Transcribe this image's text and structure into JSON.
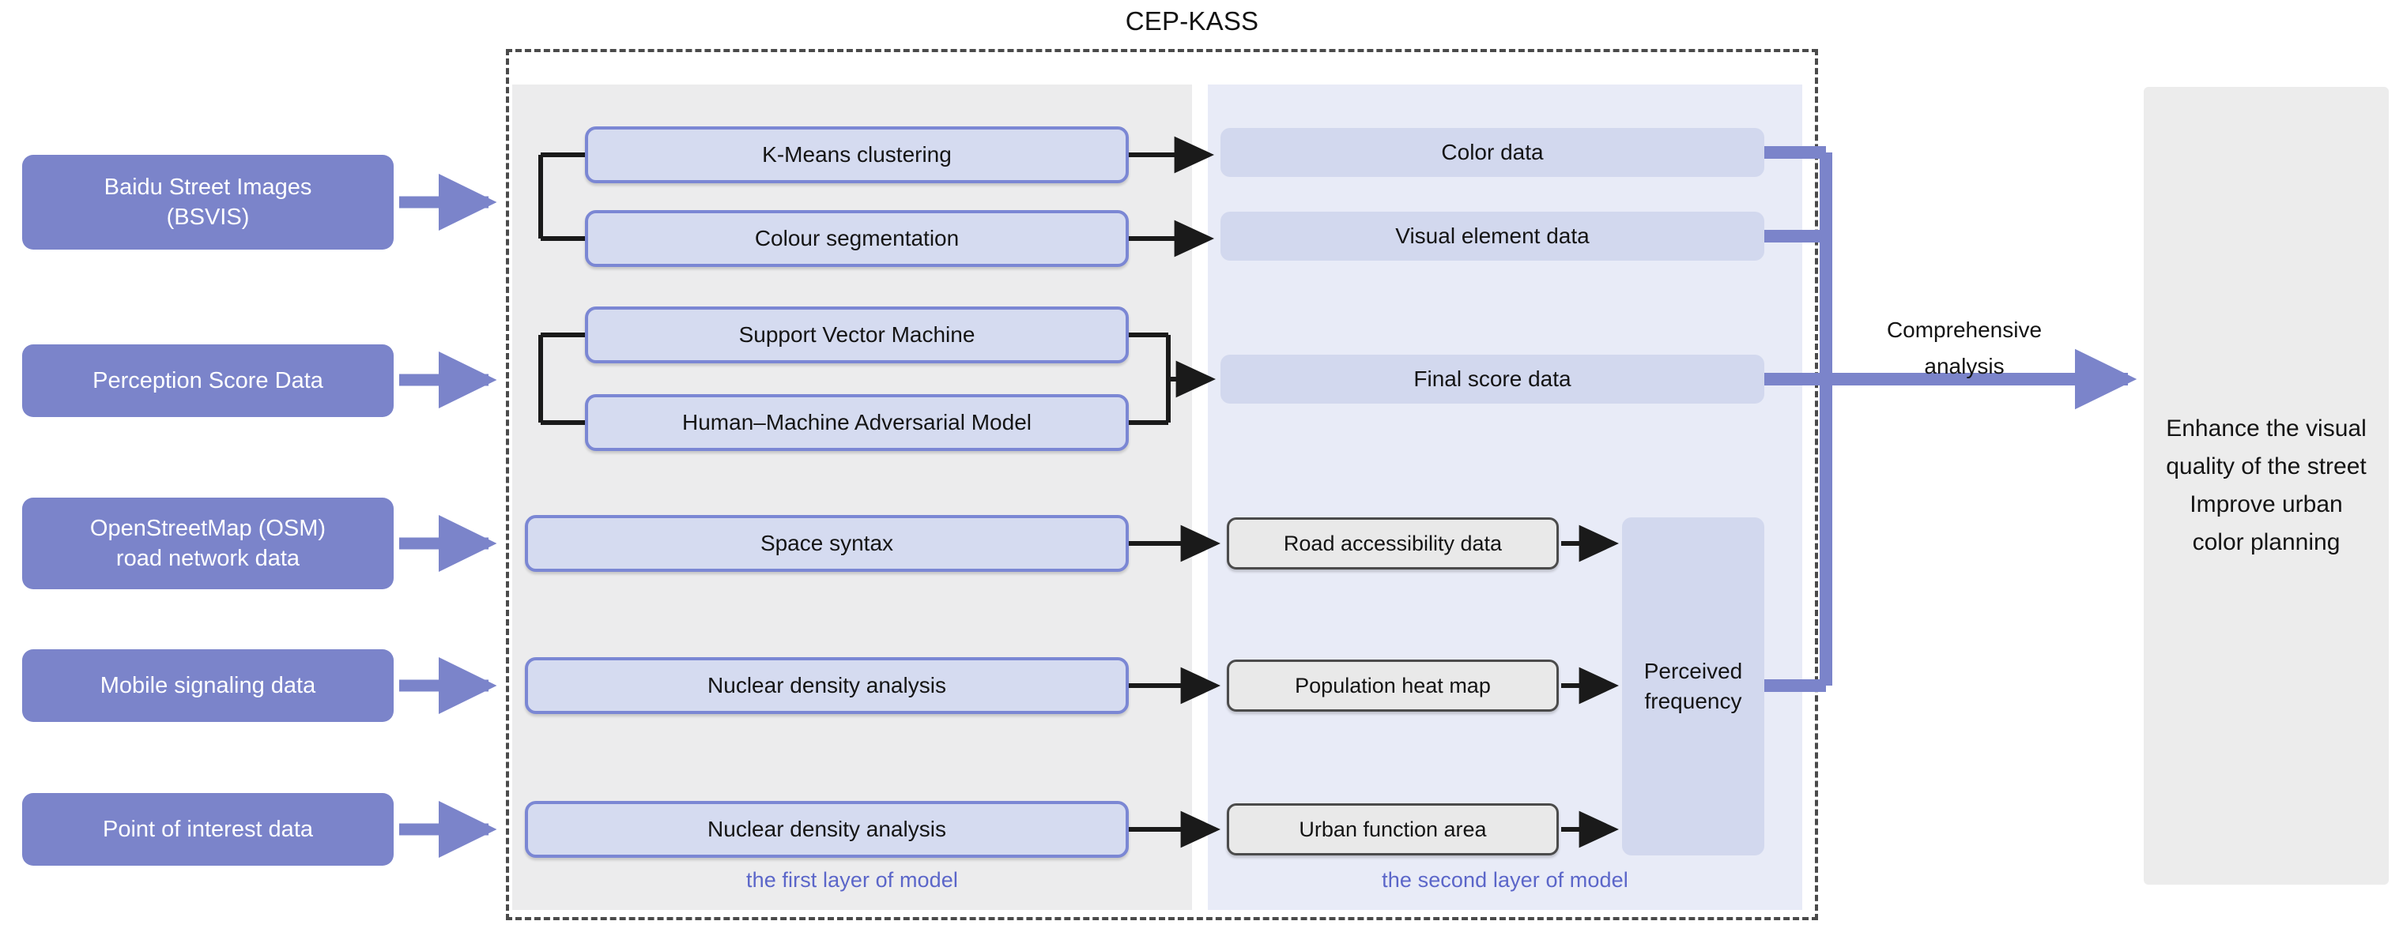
{
  "diagram": {
    "title": "CEP-KASS",
    "comprehensive_analysis_line1": "Comprehensive",
    "comprehensive_analysis_line2": "analysis",
    "first_layer_caption": "the first layer of model",
    "second_layer_caption": "the second layer of model"
  },
  "colors": {
    "source_box_fill": "#7b84ca",
    "method_box_fill": "#d5dbf0",
    "method_box_border": "#7b87d4",
    "data_box_fill": "#d2d8ee",
    "grey_box_fill": "#e9e9e9",
    "grey_box_border": "#4b4b4b",
    "panel_first_fill": "#ececed",
    "panel_second_fill": "#e8ebf7",
    "outcome_fill": "#ececec",
    "accent_arrow": "#7b84ca",
    "caption_text": "#5b66c9",
    "frame_dash": "#4a4a4a",
    "black_connector": "#1a1a1a"
  },
  "sources": [
    {
      "id": "bsvis",
      "line1": "Baidu Street Images",
      "line2": "(BSVIS)"
    },
    {
      "id": "perception",
      "line1": "Perception Score Data",
      "line2": ""
    },
    {
      "id": "osm",
      "line1": "OpenStreetMap (OSM)",
      "line2": "road network data"
    },
    {
      "id": "mobile",
      "line1": "Mobile signaling data",
      "line2": ""
    },
    {
      "id": "poi",
      "line1": "Point of interest data",
      "line2": ""
    }
  ],
  "first_layer": [
    {
      "id": "kmeans",
      "label": "K-Means clustering"
    },
    {
      "id": "colourseg",
      "label": "Colour segmentation"
    },
    {
      "id": "svm",
      "label": "Support Vector Machine"
    },
    {
      "id": "hmam",
      "label": "Human–Machine Adversarial Model"
    },
    {
      "id": "spacesyn",
      "label": "Space syntax"
    },
    {
      "id": "nda1",
      "label": "Nuclear density analysis"
    },
    {
      "id": "nda2",
      "label": "Nuclear density analysis"
    }
  ],
  "second_layer": [
    {
      "id": "colordata",
      "label": "Color data"
    },
    {
      "id": "visualdata",
      "label": "Visual element data"
    },
    {
      "id": "finalscore",
      "label": "Final score data"
    },
    {
      "id": "roadaccess",
      "label": "Road accessibility data"
    },
    {
      "id": "popheat",
      "label": "Population heat map"
    },
    {
      "id": "urbanfunc",
      "label": "Urban function area"
    }
  ],
  "aggregate": {
    "perceived_frequency_line1": "Perceived",
    "perceived_frequency_line2": "frequency"
  },
  "outcome": {
    "line1": "Enhance the visual",
    "line2": "quality of the street",
    "line3": "Improve urban",
    "line4": "color planning"
  }
}
